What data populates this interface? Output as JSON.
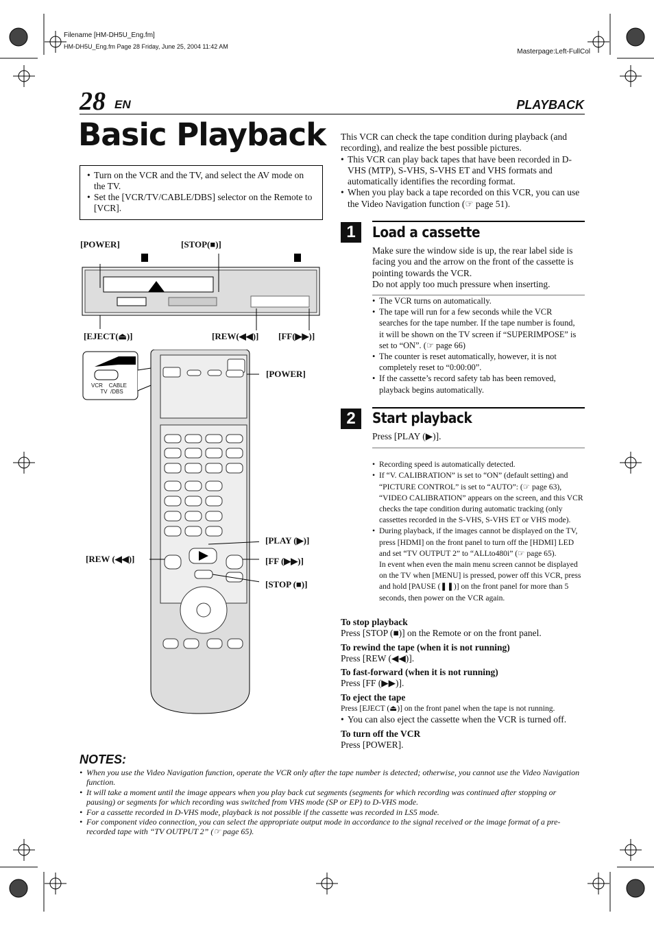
{
  "header": {
    "filename": "Filename [HM-DH5U_Eng.fm]",
    "fileinfo": "HM-DH5U_Eng.fm  Page 28  Friday, June 25, 2004  11:42 AM",
    "masterpage": "Masterpage:Left-FullCol"
  },
  "page": {
    "number": "28",
    "lang": "EN",
    "section": "PLAYBACK",
    "title": "Basic Playback"
  },
  "prep": [
    "Turn on the VCR and the TV, and select the AV mode on the TV.",
    "Set the [VCR/TV/CABLE/DBS] selector on the Remote to [VCR]."
  ],
  "intro": {
    "text": "This VCR can check the tape condition during playback (and recording), and realize the best possible pictures.",
    "bullets": [
      "This VCR can play back tapes that have been recorded in D-VHS (MTP), S-VHS, S-VHS ET and VHS formats and automatically identifies the recording format.",
      "When you play back a tape recorded on this VCR, you can use the Video Navigation function (☞ page 51)."
    ]
  },
  "step1": {
    "num": "1",
    "title": "Load a cassette",
    "text": "Make sure the window side is up, the rear label side is facing you and the arrow on the front of the cassette is pointing towards the VCR.",
    "text2": "Do not apply too much pressure when inserting.",
    "bullets": [
      "The VCR turns on automatically.",
      "The tape will run for a few seconds while the VCR searches for the tape number. If the tape number is found, it will be shown on the TV screen if “SUPERIMPOSE” is set to “ON”. (☞ page 66)",
      "The counter is reset automatically, however, it is not completely reset to “0:00:00”.",
      "If the cassette’s record safety tab has been removed, playback begins automatically."
    ]
  },
  "step2": {
    "num": "2",
    "title": "Start playback",
    "text": "Press [PLAY (▶)].",
    "bullets": [
      "Recording speed is automatically detected.",
      "If “V. CALIBRATION” is set to “ON” (default setting) and “PICTURE CONTROL” is set to “AUTO”: (☞ page 63), “VIDEO CALIBRATION” appears on the screen, and this VCR checks the tape condition during automatic tracking (only cassettes recorded in the S-VHS, S-VHS ET or VHS mode).",
      "During playback, if the images cannot be displayed on the TV, press [HDMI] on the front panel to turn off the [HDMI] LED and set “TV OUTPUT 2” to “ALLto480i” (☞ page 65).\nIn event when even the main menu screen cannot be displayed on the TV when [MENU] is pressed, power off this VCR, press and hold [PAUSE (❚❚)] on the front panel for more than 5 seconds, then power on the VCR again."
    ]
  },
  "ops": [
    {
      "title": "To stop playback",
      "text": "Press [STOP (■)] on the Remote or on the front panel."
    },
    {
      "title": "To rewind the tape (when it is not running)",
      "text": "Press [REW (◀◀)]."
    },
    {
      "title": "To fast-forward (when it is not running)",
      "text": "Press [FF (▶▶)]."
    },
    {
      "title": "To eject the tape",
      "text": "Press [EJECT (⏏)] on the front panel when the tape is not running.",
      "bullet": "You can also eject the cassette when the VCR is turned off."
    },
    {
      "title": "To turn off the VCR",
      "text": "Press [POWER]."
    }
  ],
  "diagram": {
    "vcr_labels": {
      "power": "[POWER]",
      "stop": "[STOP(■)]",
      "eject": "[EJECT(⏏)]",
      "rew": "[REW(◀◀)]",
      "ff": "[FF(▶▶)]",
      "marker1": "1",
      "marker2": "2"
    },
    "remote_labels": {
      "power": "[POWER]",
      "play": "[PLAY (▶)]",
      "rew": "[REW (◀◀)]",
      "ff": "[FF (▶▶)]",
      "stop": "[STOP (■)]"
    },
    "selector": {
      "vcr": "VCR",
      "tv": "TV",
      "cable": "CABLE",
      "dbs": "/DBS"
    }
  },
  "notes": {
    "title": "NOTES:",
    "items": [
      "When you use the Video Navigation function, operate the VCR only after the tape number is detected; otherwise, you cannot use the Video Navigation function.",
      "It will take a moment until the image appears when you play back cut segments (segments for which recording was continued after stopping or pausing) or segments for which recording was switched from VHS mode (SP or EP) to D-VHS mode.",
      "For a cassette recorded in D-VHS mode, playback is not possible if the cassette was recorded in LS5 mode.",
      "For component video connection, you can select the appropriate output mode in accordance to the signal received or the image format of  a pre-recorded tape with “TV OUTPUT 2” (☞ page 65)."
    ]
  }
}
